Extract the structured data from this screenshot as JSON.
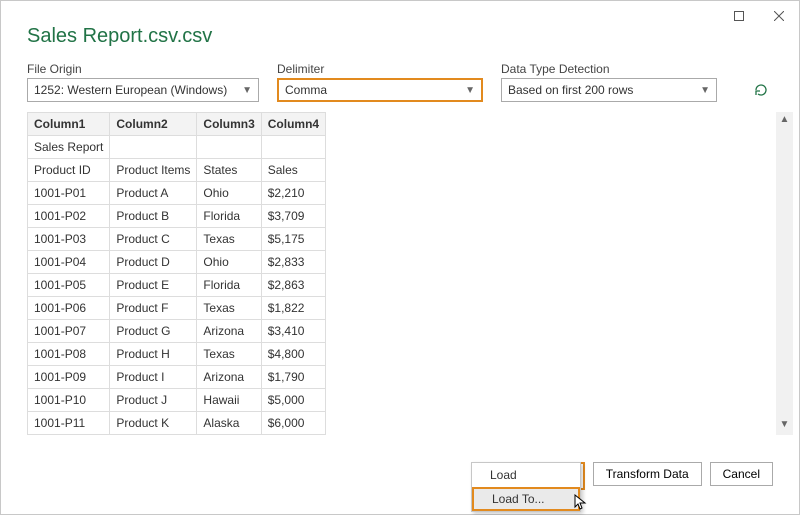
{
  "title": "Sales Report.csv.csv",
  "labels": {
    "file_origin": "File Origin",
    "delimiter": "Delimiter",
    "data_type": "Data Type Detection"
  },
  "selects": {
    "file_origin": "1252: Western European (Windows)",
    "delimiter": "Comma",
    "data_type": "Based on first 200 rows"
  },
  "columns": [
    "Column1",
    "Column2",
    "Column3",
    "Column4"
  ],
  "rows": [
    [
      "Sales Report",
      "",
      "",
      ""
    ],
    [
      "Product ID",
      "Product Items",
      "States",
      "Sales"
    ],
    [
      "1001-P01",
      "Product A",
      "Ohio",
      "$2,210"
    ],
    [
      "1001-P02",
      "Product B",
      "Florida",
      "$3,709"
    ],
    [
      "1001-P03",
      "Product C",
      "Texas",
      "$5,175"
    ],
    [
      "1001-P04",
      "Product D",
      "Ohio",
      "$2,833"
    ],
    [
      "1001-P05",
      "Product E",
      "Florida",
      "$2,863"
    ],
    [
      "1001-P06",
      "Product F",
      "Texas",
      "$1,822"
    ],
    [
      "1001-P07",
      "Product G",
      "Arizona",
      "$3,410"
    ],
    [
      "1001-P08",
      "Product H",
      "Texas",
      "$4,800"
    ],
    [
      "1001-P09",
      "Product I",
      "Arizona",
      "$1,790"
    ],
    [
      "1001-P10",
      "Product J",
      "Hawaii",
      "$5,000"
    ],
    [
      "1001-P11",
      "Product K",
      "Alaska",
      "$6,000"
    ]
  ],
  "buttons": {
    "load": "Load",
    "transform": "Transform Data",
    "cancel": "Cancel"
  },
  "menu": {
    "load": "Load",
    "load_to": "Load To..."
  }
}
